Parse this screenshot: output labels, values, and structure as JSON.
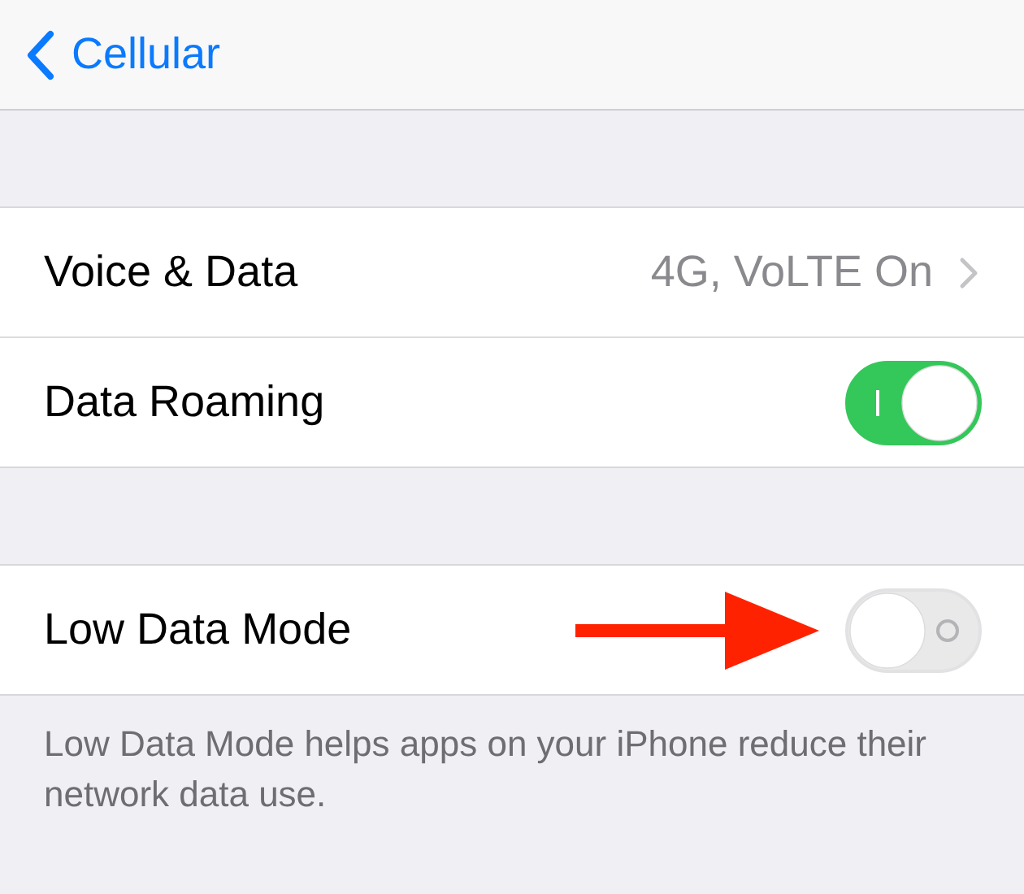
{
  "nav": {
    "back_label": "Cellular"
  },
  "groups": [
    {
      "rows": [
        {
          "kind": "detail",
          "label": "Voice & Data",
          "value": "4G, VoLTE On"
        },
        {
          "kind": "toggle",
          "label": "Data Roaming",
          "on": true
        }
      ]
    },
    {
      "rows": [
        {
          "kind": "toggle",
          "label": "Low Data Mode",
          "on": false
        }
      ],
      "footer": "Low Data Mode helps apps on your iPhone reduce their network data use."
    }
  ]
}
